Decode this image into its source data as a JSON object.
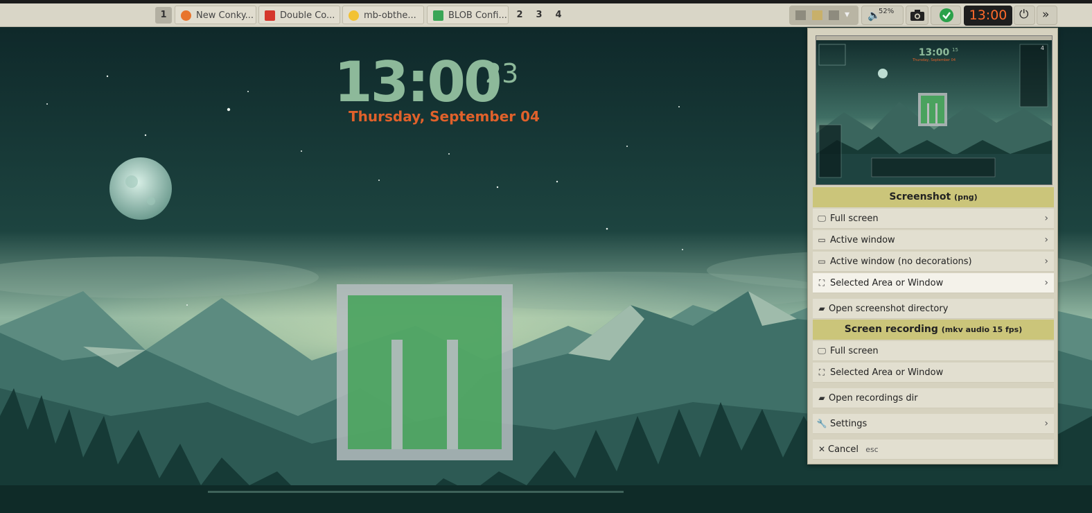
{
  "panel": {
    "workspaces": [
      "1",
      "2",
      "3",
      "4"
    ],
    "active_workspace": "1",
    "tasks": [
      {
        "label": "New Conky...",
        "icon": "firefox-icon",
        "color": "#e8742c"
      },
      {
        "label": "Double Co...",
        "icon": "double-commander-icon",
        "color": "#d5372c"
      },
      {
        "label": "mb-obthe...",
        "icon": "obthemes-icon",
        "color": "#f2c233"
      },
      {
        "label": "BLOB Confi...",
        "icon": "blob-config-icon",
        "color": "#3aa656"
      }
    ],
    "volume": "52%",
    "clock": "13:00"
  },
  "conky": {
    "time": "13:00",
    "seconds": "23",
    "date": "Thursday, September 04"
  },
  "menu": {
    "preview": {
      "time": "13:00",
      "seconds": "15",
      "date": "Thursday, September 04",
      "day_number": "4"
    },
    "screenshot_header": "Screenshot",
    "screenshot_header_detail": "(png)",
    "screenshot_items": [
      {
        "label": "Full screen",
        "icon": "monitor-icon",
        "submenu": true
      },
      {
        "label": "Active window",
        "icon": "window-icon",
        "submenu": true
      },
      {
        "label": "Active window (no decorations)",
        "icon": "window-icon",
        "submenu": true
      },
      {
        "label": "Selected Area or Window",
        "icon": "area-select-icon",
        "submenu": true
      }
    ],
    "open_screenshot_dir": "Open screenshot directory",
    "recording_header": "Screen recording",
    "recording_header_detail": "(mkv audio 15 fps)",
    "recording_items": [
      {
        "label": "Full screen",
        "icon": "monitor-icon"
      },
      {
        "label": "Selected Area or Window",
        "icon": "area-select-icon"
      }
    ],
    "open_recordings_dir": "Open recordings dir",
    "settings": "Settings",
    "cancel": "Cancel",
    "cancel_hint": "esc"
  },
  "colors": {
    "accent_clock": "#ff6a2b",
    "conky_time": "#8db99a",
    "conky_date": "#e0612b",
    "menu_header": "#cbc57a"
  }
}
